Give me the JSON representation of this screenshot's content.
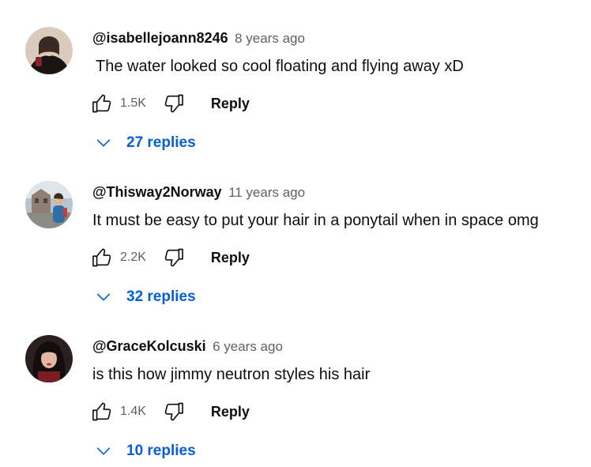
{
  "comments": [
    {
      "author": "@isabellejoann8246",
      "time": "8 years ago",
      "text": "The water looked so cool floating and flying away xD",
      "likes": "1.5K",
      "reply_label": "Reply",
      "replies_label": "27 replies"
    },
    {
      "author": "@Thisway2Norway",
      "time": "11 years ago",
      "text": "It must be easy to put your hair in a ponytail when in space omg",
      "likes": "2.2K",
      "reply_label": "Reply",
      "replies_label": "32 replies"
    },
    {
      "author": "@GraceKolcuski",
      "time": "6 years ago",
      "text": "is this how jimmy neutron styles his hair",
      "likes": "1.4K",
      "reply_label": "Reply",
      "replies_label": "10 replies"
    }
  ],
  "icons": {
    "like": "thumb-up-icon",
    "dislike": "thumb-down-icon",
    "expand": "chevron-down-icon"
  },
  "colors": {
    "link_blue": "#065fd4",
    "secondary_text": "#606060",
    "primary_text": "#0f0f0f"
  }
}
